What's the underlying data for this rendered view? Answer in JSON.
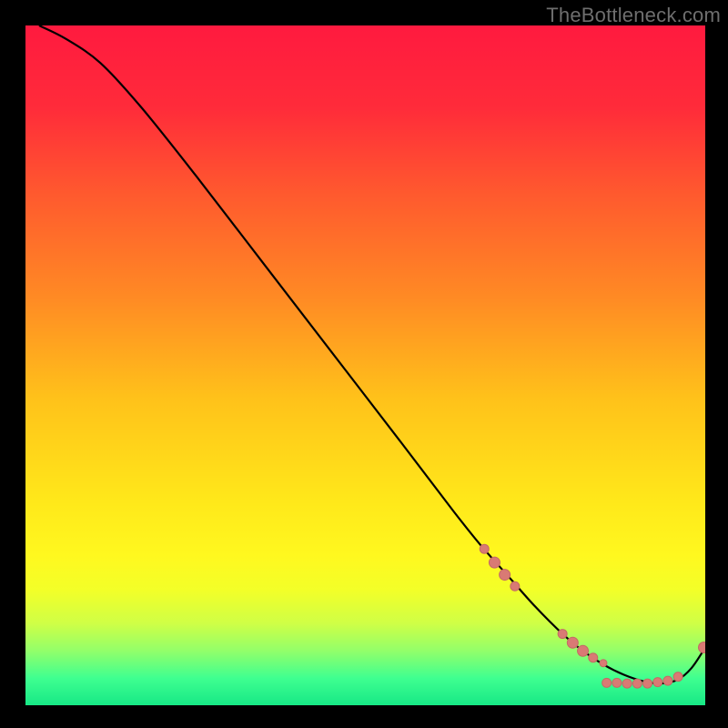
{
  "watermark": "TheBottleneck.com",
  "colors": {
    "gradient_stops": [
      {
        "offset": 0.0,
        "color": "#ff1a3f"
      },
      {
        "offset": 0.12,
        "color": "#ff2b3a"
      },
      {
        "offset": 0.25,
        "color": "#ff5a2e"
      },
      {
        "offset": 0.4,
        "color": "#ff8a24"
      },
      {
        "offset": 0.55,
        "color": "#ffc21a"
      },
      {
        "offset": 0.7,
        "color": "#ffe81a"
      },
      {
        "offset": 0.78,
        "color": "#fff81f"
      },
      {
        "offset": 0.83,
        "color": "#f3ff28"
      },
      {
        "offset": 0.88,
        "color": "#cfff46"
      },
      {
        "offset": 0.92,
        "color": "#92ff6a"
      },
      {
        "offset": 0.96,
        "color": "#3fff90"
      },
      {
        "offset": 1.0,
        "color": "#17e886"
      }
    ],
    "curve": "#000000",
    "marker_fill": "#d97a74",
    "marker_stroke": "#c46a64"
  },
  "chart_data": {
    "type": "line",
    "title": "",
    "xlabel": "",
    "ylabel": "",
    "xlim": [
      0,
      100
    ],
    "ylim": [
      0,
      100
    ],
    "series": [
      {
        "name": "curve",
        "x": [
          2,
          6,
          11,
          17,
          25,
          35,
          45,
          55,
          63,
          67,
          71,
          75,
          79,
          82,
          85,
          88,
          91,
          93.5,
          96,
          98,
          100
        ],
        "y": [
          100,
          98,
          94.5,
          88,
          78,
          65,
          52,
          39,
          28.5,
          23.5,
          19,
          14.5,
          10.5,
          8,
          6,
          4.5,
          3.5,
          3.2,
          3.8,
          5.5,
          8.5
        ]
      }
    ],
    "markers_scatter": {
      "name": "highlighted-points",
      "points": [
        {
          "x": 67.5,
          "y": 23.0,
          "r": 5
        },
        {
          "x": 69.0,
          "y": 21.0,
          "r": 6
        },
        {
          "x": 70.5,
          "y": 19.2,
          "r": 6
        },
        {
          "x": 72.0,
          "y": 17.5,
          "r": 5
        },
        {
          "x": 79.0,
          "y": 10.5,
          "r": 5
        },
        {
          "x": 80.5,
          "y": 9.2,
          "r": 6
        },
        {
          "x": 82.0,
          "y": 8.0,
          "r": 6
        },
        {
          "x": 83.5,
          "y": 7.0,
          "r": 5
        },
        {
          "x": 85.0,
          "y": 6.2,
          "r": 4
        },
        {
          "x": 85.5,
          "y": 3.3,
          "r": 5
        },
        {
          "x": 87.0,
          "y": 3.3,
          "r": 5
        },
        {
          "x": 88.5,
          "y": 3.2,
          "r": 5
        },
        {
          "x": 90.0,
          "y": 3.2,
          "r": 5
        },
        {
          "x": 91.5,
          "y": 3.2,
          "r": 5
        },
        {
          "x": 93.0,
          "y": 3.4,
          "r": 5
        },
        {
          "x": 94.5,
          "y": 3.6,
          "r": 5
        },
        {
          "x": 96.0,
          "y": 4.2,
          "r": 5
        },
        {
          "x": 99.8,
          "y": 8.5,
          "r": 6
        }
      ]
    }
  }
}
